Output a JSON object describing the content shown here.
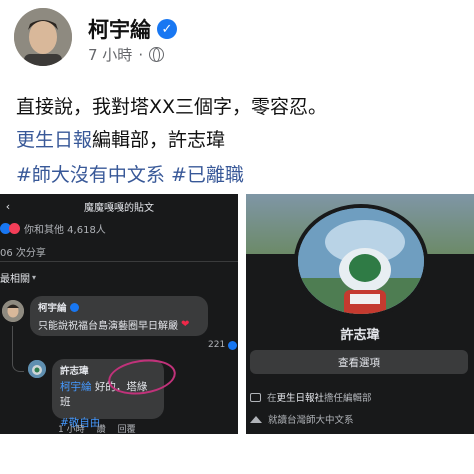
{
  "post": {
    "author": "柯宇綸",
    "time": "7 小時",
    "separator": "·",
    "line1": "直接說，我對塔XX三個字，零容忍。",
    "line2_link": "更生日報",
    "line2_rest": "編輯部，許志瑋",
    "hashtag1": "#師大沒有中文系",
    "hashtag2": "#已離職"
  },
  "left_screenshot": {
    "back_icon": "‹",
    "nav_title": "魔魔嘎嘎的貼文",
    "reactions_text": "你和其他 4,618人",
    "shares_text": "06 次分享",
    "sort_label": "最相關",
    "sort_caret": "▾",
    "comment1": {
      "author": "柯宇綸",
      "text": "只能說祝福台島演藝圈早日解嚴",
      "heart": "❤",
      "reaction_count": "221"
    },
    "comment2": {
      "author": "許志瑋",
      "mention": "柯宇綸",
      "text": " 好的，塔綠班",
      "hashtag": "#敬自由",
      "time": "1 小時",
      "like": "讚",
      "reply": "回覆"
    }
  },
  "right_screenshot": {
    "name": "許志瑋",
    "button_label": "查看選項",
    "info1_prefix": "在",
    "info1_org": "更生日報社",
    "info1_suffix": "擔任編輯部",
    "info2": "就讀台灣師大中文系"
  },
  "colors": {
    "link": "#385898",
    "verified": "#1877f2",
    "dark_bg": "#18191a",
    "bubble": "#3a3b3c",
    "circle_mark": "#c0327a"
  },
  "icons": [
    "globe-icon",
    "verified-badge-icon",
    "back-icon",
    "heart-icon",
    "briefcase-icon",
    "graduation-cap-icon"
  ]
}
